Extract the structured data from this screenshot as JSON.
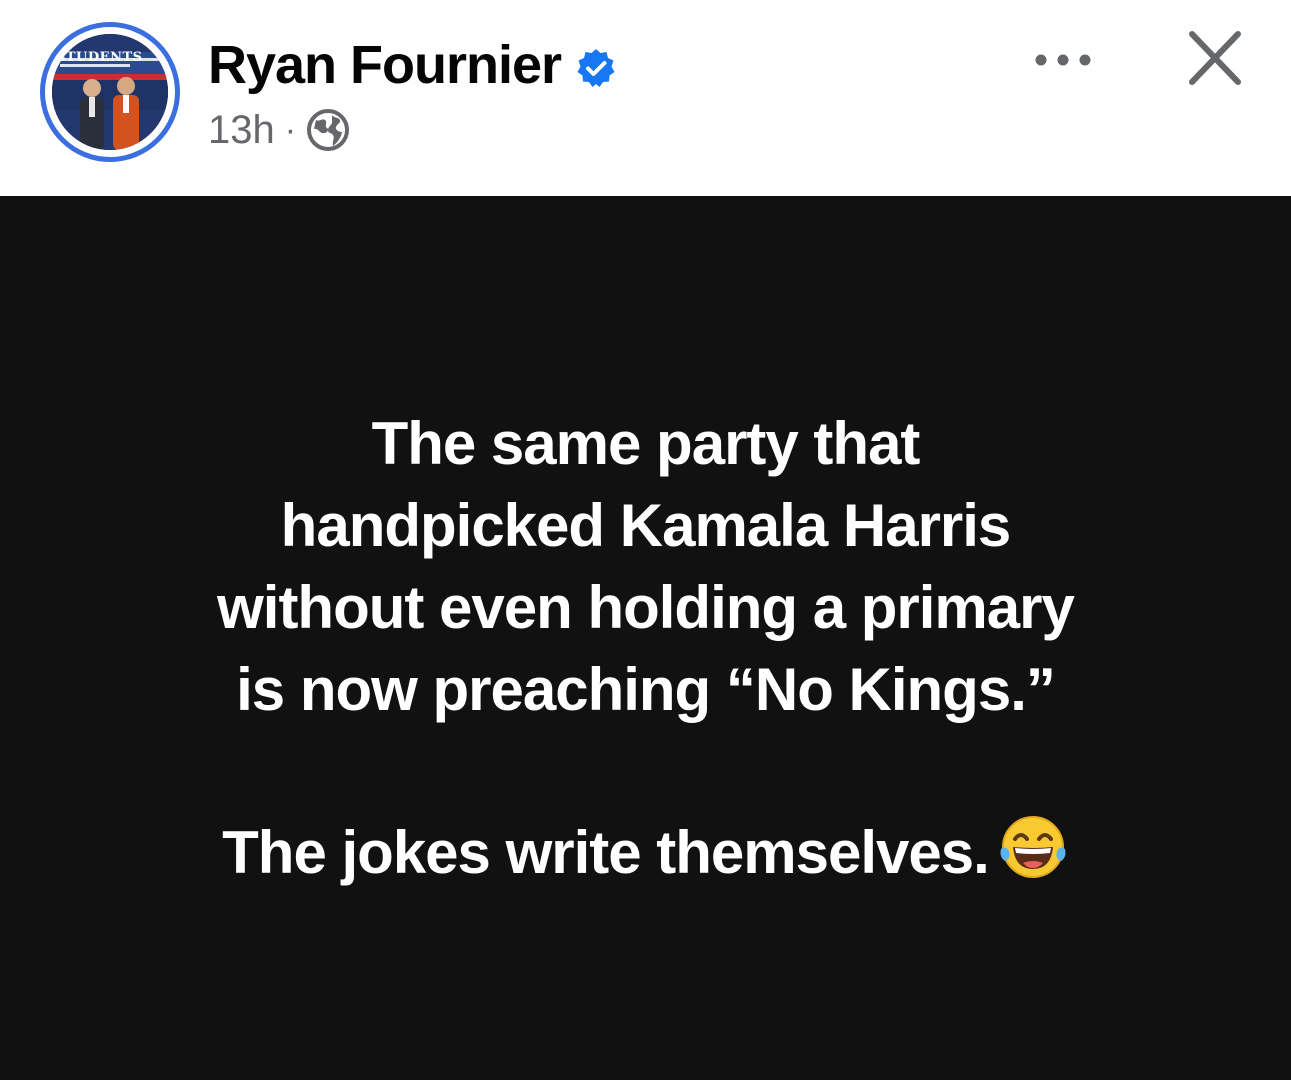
{
  "post": {
    "author": {
      "name": "Ryan Fournier",
      "verified": true,
      "avatar_icon": "profile-photo",
      "avatar_banner_text": "STUDENTS"
    },
    "timestamp": "13h",
    "separator": "·",
    "audience_icon": "globe-icon",
    "actions": {
      "more_icon": "more-options-icon",
      "close_icon": "close-icon"
    },
    "body": {
      "background_color": "#111111",
      "text_color": "#ffffff",
      "line1": "The same party that",
      "line2": "handpicked Kamala Harris",
      "line3": "without even holding a primary",
      "line4": "is now preaching “No Kings.”",
      "line5": "The jokes write themselves.",
      "emoji": "laughing-tears-emoji"
    }
  },
  "colors": {
    "verified_blue": "#1877f2",
    "avatar_ring": "#3b6fe0",
    "meta_gray": "#65676b"
  }
}
